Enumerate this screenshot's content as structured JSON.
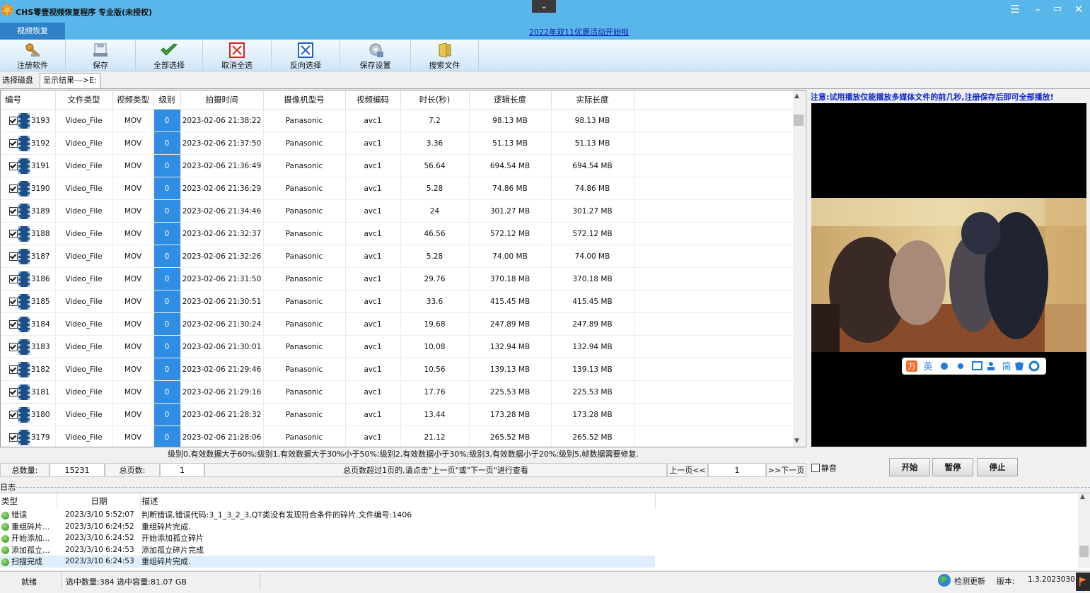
{
  "window": {
    "title": "CHS零壹视频恢复程序 专业版(未授权)",
    "menu_glyph": "☰",
    "minimize_glyph": "–",
    "restore_glyph": "▭",
    "close_glyph": "✕",
    "dropdown_glyph": "⌄"
  },
  "main_tab": "视频恢复",
  "promo_link": "2022年双11优惠活动开始啦",
  "toolbar": [
    {
      "label": "注册软件",
      "icon": "key-icon"
    },
    {
      "label": "保存",
      "icon": "save-icon"
    },
    {
      "label": "全部选择",
      "icon": "checkmark-icon"
    },
    {
      "label": "取消全选",
      "icon": "box-x-icon"
    },
    {
      "label": "反向选择",
      "icon": "invert-selection-icon"
    },
    {
      "label": "保存设置",
      "icon": "settings-icon"
    },
    {
      "label": "搜索文件",
      "icon": "search-folder-icon"
    }
  ],
  "sub_tabs": {
    "select_disk": "选择磁盘",
    "results": "显示结果--->E:"
  },
  "grid": {
    "columns": [
      "编号",
      "文件类型",
      "视频类型",
      "级别",
      "拍摄时间",
      "摄像机型号",
      "视频编码",
      "时长(秒)",
      "逻辑长度",
      "实际长度"
    ],
    "rows": [
      [
        "3193",
        "Video_File",
        "MOV",
        "0",
        "2023-02-06 21:38:22",
        "Panasonic",
        "avc1",
        "7.2",
        "98.13 MB",
        "98.13 MB"
      ],
      [
        "3192",
        "Video_File",
        "MOV",
        "0",
        "2023-02-06 21:37:50",
        "Panasonic",
        "avc1",
        "3.36",
        "51.13 MB",
        "51.13 MB"
      ],
      [
        "3191",
        "Video_File",
        "MOV",
        "0",
        "2023-02-06 21:36:49",
        "Panasonic",
        "avc1",
        "56.64",
        "694.54 MB",
        "694.54 MB"
      ],
      [
        "3190",
        "Video_File",
        "MOV",
        "0",
        "2023-02-06 21:36:29",
        "Panasonic",
        "avc1",
        "5.28",
        "74.86 MB",
        "74.86 MB"
      ],
      [
        "3189",
        "Video_File",
        "MOV",
        "0",
        "2023-02-06 21:34:46",
        "Panasonic",
        "avc1",
        "24",
        "301.27 MB",
        "301.27 MB"
      ],
      [
        "3188",
        "Video_File",
        "MOV",
        "0",
        "2023-02-06 21:32:37",
        "Panasonic",
        "avc1",
        "46.56",
        "572.12 MB",
        "572.12 MB"
      ],
      [
        "3187",
        "Video_File",
        "MOV",
        "0",
        "2023-02-06 21:32:26",
        "Panasonic",
        "avc1",
        "5.28",
        "74.00 MB",
        "74.00 MB"
      ],
      [
        "3186",
        "Video_File",
        "MOV",
        "0",
        "2023-02-06 21:31:50",
        "Panasonic",
        "avc1",
        "29.76",
        "370.18 MB",
        "370.18 MB"
      ],
      [
        "3185",
        "Video_File",
        "MOV",
        "0",
        "2023-02-06 21:30:51",
        "Panasonic",
        "avc1",
        "33.6",
        "415.45 MB",
        "415.45 MB"
      ],
      [
        "3184",
        "Video_File",
        "MOV",
        "0",
        "2023-02-06 21:30:24",
        "Panasonic",
        "avc1",
        "19.68",
        "247.89 MB",
        "247.89 MB"
      ],
      [
        "3183",
        "Video_File",
        "MOV",
        "0",
        "2023-02-06 21:30:01",
        "Panasonic",
        "avc1",
        "10.08",
        "132.94 MB",
        "132.94 MB"
      ],
      [
        "3182",
        "Video_File",
        "MOV",
        "0",
        "2023-02-06 21:29:46",
        "Panasonic",
        "avc1",
        "10.56",
        "139.13 MB",
        "139.13 MB"
      ],
      [
        "3181",
        "Video_File",
        "MOV",
        "0",
        "2023-02-06 21:29:16",
        "Panasonic",
        "avc1",
        "17.76",
        "225.53 MB",
        "225.53 MB"
      ],
      [
        "3180",
        "Video_File",
        "MOV",
        "0",
        "2023-02-06 21:28:32",
        "Panasonic",
        "avc1",
        "13.44",
        "173.28 MB",
        "173.28 MB"
      ],
      [
        "3179",
        "Video_File",
        "MOV",
        "0",
        "2023-02-06 21:28:06",
        "Panasonic",
        "avc1",
        "21.12",
        "265.52 MB",
        "265.52 MB"
      ]
    ],
    "level_color": "#2f8de4"
  },
  "legend_note": "级别0,有效数据大于60%;级别1,有效数据大于30%小于50%;级别2,有效数据小于30%;级别3,有效数据小于20%;级别5,帧数据需要修复.",
  "pager": {
    "total_label": "总数量:",
    "total_value": "15231",
    "pages_label": "总页数:",
    "pages_value": "1",
    "hint": "总页数超过1页的,请点击\"上一页\"或\"下一页\"进行查看",
    "prev": "上一页<<",
    "current": "1",
    "next": ">>下一页"
  },
  "preview": {
    "warning": "注意:试用播放仅能播放多媒体文件的前几秒,注册保存后即可全部播放!",
    "mute": "静音",
    "start": "开始",
    "pause": "暂停",
    "stop": "停止",
    "ime_items": [
      "英",
      "简"
    ]
  },
  "log": {
    "label": "日志",
    "columns": [
      "类型",
      "日期",
      "描述"
    ],
    "rows": [
      [
        "错误",
        "2023/3/10 5:52:07",
        "判断错误,错误代码:3_1_3_2_3,QT类没有发现符合条件的碎片.文件编号:1406"
      ],
      [
        "重组碎片...",
        "2023/3/10 6:24:52",
        "重组碎片完成."
      ],
      [
        "开始添加...",
        "2023/3/10 6:24:52",
        "开始添加孤立碎片"
      ],
      [
        "添加孤立...",
        "2023/3/10 6:24:53",
        "添加孤立碎片完成"
      ],
      [
        "扫描完成",
        "2023/3/10 6:24:53",
        "重组碎片完成."
      ]
    ]
  },
  "status": {
    "ready": "就绪",
    "selection": "选中数量:384 选中容量:81.07 GB",
    "check_update": "检测更新",
    "version_label": "版本:",
    "version_value": "1.3.2023030"
  }
}
